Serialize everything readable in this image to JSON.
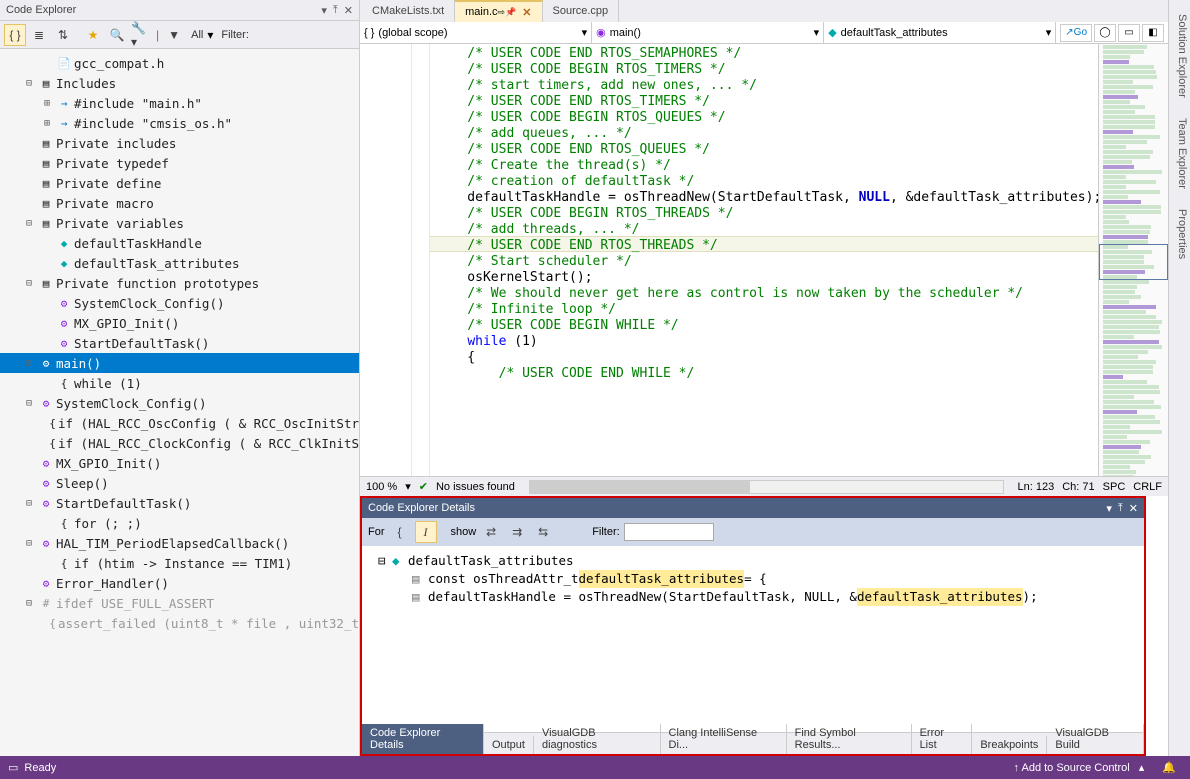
{
  "left_panel_title": "Code Explorer",
  "filter_label": "All",
  "filter_prefix": "Filter:",
  "tree": [
    {
      "indent": 2,
      "icon": "file",
      "text": "gcc_compat.h"
    },
    {
      "indent": 1,
      "twisty": "-",
      "icon": "folder",
      "text": "Includes"
    },
    {
      "indent": 2,
      "twisty": "+",
      "icon": "inc",
      "text": "#include \"main.h\""
    },
    {
      "indent": 2,
      "twisty": "+",
      "icon": "inc",
      "text": "#include \"cmsis_os.h\""
    },
    {
      "indent": 1,
      "icon": "folder",
      "text": "Private includes"
    },
    {
      "indent": 1,
      "icon": "folder",
      "text": "Private typedef"
    },
    {
      "indent": 1,
      "icon": "folder",
      "text": "Private define"
    },
    {
      "indent": 1,
      "icon": "folder",
      "text": "Private macro"
    },
    {
      "indent": 1,
      "twisty": "-",
      "icon": "folder",
      "text": "Private variables"
    },
    {
      "indent": 2,
      "icon": "var",
      "text": "defaultTaskHandle"
    },
    {
      "indent": 2,
      "icon": "var",
      "text": "defaultTask_attributes"
    },
    {
      "indent": 1,
      "twisty": "-",
      "icon": "folder",
      "text": "Private function prototypes"
    },
    {
      "indent": 2,
      "icon": "fn",
      "text": "SystemClock_Config()"
    },
    {
      "indent": 2,
      "icon": "fn",
      "text": "MX_GPIO_Init()"
    },
    {
      "indent": 2,
      "icon": "fn",
      "text": "StartDefaultTask()"
    },
    {
      "indent": 1,
      "twisty": "-",
      "icon": "fn-sel",
      "text": "main()",
      "selected": true
    },
    {
      "indent": 2,
      "icon": "brace",
      "text": "while (1)"
    },
    {
      "indent": 1,
      "twisty": "-",
      "icon": "fn",
      "text": "SystemClock_Config()"
    },
    {
      "indent": 2,
      "icon": "brace",
      "text": "if (HAL_RCC_OscConfig ( & RCC_OscInitStr"
    },
    {
      "indent": 2,
      "icon": "brace",
      "text": "if (HAL_RCC_ClockConfig ( & RCC_ClkInitS"
    },
    {
      "indent": 1,
      "icon": "fn",
      "text": "MX_GPIO_Init()"
    },
    {
      "indent": 1,
      "icon": "fn",
      "text": "Sleep()"
    },
    {
      "indent": 1,
      "twisty": "-",
      "icon": "fn",
      "text": "StartDefaultTask()"
    },
    {
      "indent": 2,
      "icon": "brace",
      "text": "for (; ;)"
    },
    {
      "indent": 1,
      "twisty": "-",
      "icon": "fn",
      "text": "HAL_TIM_PeriodElapsedCallback()"
    },
    {
      "indent": 2,
      "icon": "brace",
      "text": "if (htim -> Instance == TIM1)"
    },
    {
      "indent": 1,
      "icon": "fn",
      "text": "Error_Handler()"
    },
    {
      "indent": 1,
      "twisty": "-",
      "icon": "pp",
      "text": "ifdef USE_FULL_ASSERT",
      "disabled": true
    },
    {
      "indent": 2,
      "icon": "brace",
      "text": "assert_failed (uint8_t * file , uint32_t",
      "disabled": true
    }
  ],
  "doc_tabs": [
    {
      "label": "CMakeLists.txt",
      "active": false
    },
    {
      "label": "main.c",
      "active": true,
      "pinned": true
    },
    {
      "label": "Source.cpp",
      "active": false
    }
  ],
  "scope": {
    "s1": "(global scope)",
    "s2": "main()",
    "s3": "defaultTask_attributes",
    "go": "Go"
  },
  "code_lines": [
    {
      "t": "    /* USER CODE END RTOS_SEMAPHORES */",
      "c": "g"
    },
    {
      "t": ""
    },
    {
      "t": "    /* USER CODE BEGIN RTOS_TIMERS */",
      "c": "g"
    },
    {
      "t": "    /* start timers, add new ones, ... */",
      "c": "g"
    },
    {
      "t": "    /* USER CODE END RTOS_TIMERS */",
      "c": "g"
    },
    {
      "t": ""
    },
    {
      "t": "    /* USER CODE BEGIN RTOS_QUEUES */",
      "c": "g"
    },
    {
      "t": "    /* add queues, ... */",
      "c": "g"
    },
    {
      "t": "    /* USER CODE END RTOS_QUEUES */",
      "c": "g"
    },
    {
      "t": ""
    },
    {
      "t": "    /* Create the thread(s) */",
      "c": "g"
    },
    {
      "t": "    /* creation of defaultTask */",
      "c": "g"
    },
    {
      "t": "    defaultTaskHandle = osThreadNew(StartDefaultTask, NULL, &defaultTask_attributes);",
      "c": "mix",
      "hl": true
    },
    {
      "t": ""
    },
    {
      "t": "    /* USER CODE BEGIN RTOS_THREADS */",
      "c": "g"
    },
    {
      "t": "    /* add threads, ... */",
      "c": "g"
    },
    {
      "t": "    /* USER CODE END RTOS_THREADS */",
      "c": "g"
    },
    {
      "t": ""
    },
    {
      "t": "    /* Start scheduler */",
      "c": "g"
    },
    {
      "t": "    osKernelStart();"
    },
    {
      "t": ""
    },
    {
      "t": "    /* We should never get here as control is now taken by the scheduler */",
      "c": "g"
    },
    {
      "t": "    /* Infinite loop */",
      "c": "g"
    },
    {
      "t": "    /* USER CODE BEGIN WHILE */",
      "c": "g"
    },
    {
      "t": "    while (1)",
      "c": "k2"
    },
    {
      "t": "    {"
    },
    {
      "t": "        /* USER CODE END WHILE */",
      "c": "g"
    }
  ],
  "editor_status": {
    "zoom": "100 %",
    "issues": "No issues found",
    "ln": "Ln: 123",
    "ch": "Ch: 71",
    "ins": "SPC",
    "eol": "CRLF"
  },
  "details": {
    "title": "Code Explorer Details",
    "for": "For",
    "show": "show",
    "filter": "Filter:",
    "rows": [
      {
        "indent": 0,
        "twisty": "-",
        "icon": "var",
        "text": "defaultTask_attributes"
      },
      {
        "indent": 1,
        "icon": "doc",
        "richtext": "const osThreadAttr_t <hl>defaultTask_attributes</hl> = {"
      },
      {
        "indent": 1,
        "icon": "doc",
        "richtext": "defaultTaskHandle = osThreadNew(StartDefaultTask, NULL, &<hl>defaultTask_attributes</hl>);"
      }
    ]
  },
  "bottom_tabs": [
    "Code Explorer Details",
    "Output",
    "VisualGDB diagnostics",
    "Clang IntelliSense Di...",
    "Find Symbol Results...",
    "Error List",
    "Breakpoints",
    "VisualGDB Build"
  ],
  "side_tabs": [
    "Solution Explorer",
    "Team Explorer",
    "Properties"
  ],
  "status": {
    "ready": "Ready",
    "add": "Add to Source Control"
  }
}
